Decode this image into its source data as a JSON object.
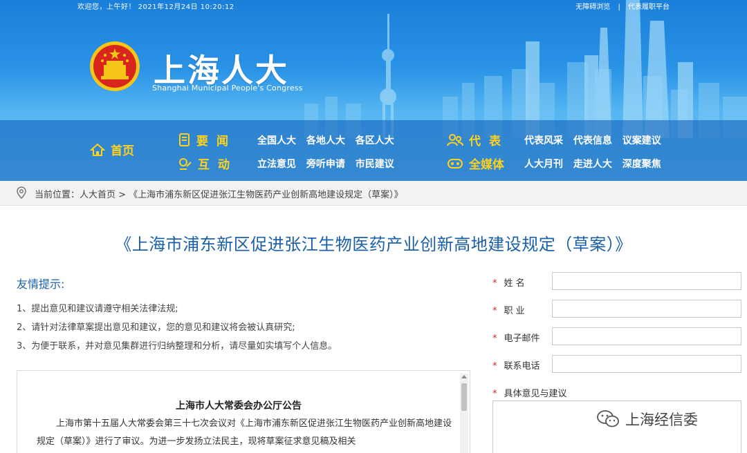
{
  "topbar": {
    "greeting": "欢迎您，上午好！  2021年12月24日  10:20:12",
    "accessible": "无障碍浏览",
    "separator": "|",
    "platform": "代表履职平台"
  },
  "logo": {
    "cn": "上海人大",
    "en": "Shanghai Municipal People's Congress"
  },
  "nav": {
    "home": "首页",
    "news": "要闻",
    "news_links": [
      "全国人大",
      "各地人大",
      "各区人大"
    ],
    "interact": "互动",
    "interact_links": [
      "立法意见",
      "旁听申请",
      "市民建议"
    ],
    "deputies": "代表",
    "deputies_links": [
      "代表风采",
      "代表信息",
      "议案建议"
    ],
    "media": "全媒体",
    "media_links": [
      "人大月刊",
      "走进人大",
      "深度聚焦"
    ]
  },
  "breadcrumb": {
    "text": "当前位置：人大首页 > 《上海市浦东新区促进张江生物医药产业创新高地建设规定（草案）》"
  },
  "page": {
    "title": "《上海市浦东新区促进张江生物医药产业创新高地建设规定（草案）》"
  },
  "tips": {
    "title": "友情提示:",
    "items": [
      "1、提出意见和建议请遵守相关法律法规;",
      "2、请针对法律草案提出意见和建议，您的意见和建议将会被认真研究;",
      "3、为便于联系，并对意见集群进行归纳整理和分析，请尽量如实填写个人信息。"
    ]
  },
  "notice": {
    "title": "上海市人大常委会办公厅公告",
    "body": "上海市第十五届人大常委会第三十七次会议对《上海市浦东新区促进张江生物医药产业创新高地建设规定（草案）》进行了审议。为进一步发扬立法民主，现将草案征求意见稿及相关"
  },
  "form": {
    "required_mark": "*",
    "name_label": "姓 名",
    "job_label": "职 业",
    "email_label": "电子邮件",
    "phone_label": "联系电话",
    "opinion_label": "具体意见与建议",
    "name_value": "",
    "job_value": "",
    "email_value": "",
    "phone_value": ""
  },
  "watermark": {
    "text": "上海经信委"
  },
  "colors": {
    "banner_blue": "#1a7fd9",
    "nav_yellow": "#ffd21c",
    "title_blue": "#1a5fa8",
    "required_red": "#e02020"
  },
  "icons": {
    "home": "home-icon",
    "news": "document-icon",
    "interact": "chat-edit-icon",
    "deputies": "people-icon",
    "media": "media-icon",
    "location": "location-pin-icon",
    "wechat": "wechat-icon"
  }
}
